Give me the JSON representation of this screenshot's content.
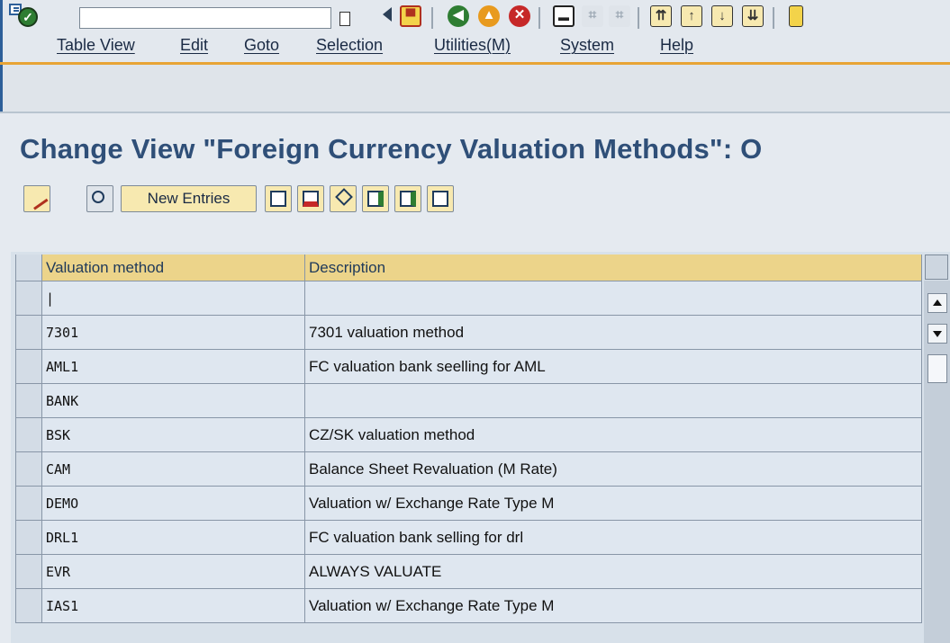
{
  "menu": {
    "items": [
      "Table View",
      "Edit",
      "Goto",
      "Selection",
      "Utilities(M)",
      "System",
      "Help"
    ]
  },
  "toolbar": {
    "command_value": ""
  },
  "page": {
    "title": "Change View \"Foreign Currency Valuation Methods\": O"
  },
  "app_toolbar": {
    "new_entries_label": "New Entries"
  },
  "table": {
    "columns": [
      "Valuation method",
      "Description"
    ],
    "rows": [
      {
        "method": "|",
        "description": ""
      },
      {
        "method": "7301",
        "description": "7301 valuation method"
      },
      {
        "method": "AML1",
        "description": "FC valuation bank seelling for AML"
      },
      {
        "method": "BANK",
        "description": ""
      },
      {
        "method": "BSK",
        "description": "CZ/SK valuation method"
      },
      {
        "method": "CAM",
        "description": "Balance Sheet Revaluation (M Rate)"
      },
      {
        "method": "DEMO",
        "description": "Valuation w/ Exchange Rate Type M"
      },
      {
        "method": "DRL1",
        "description": "FC valuation bank selling for drl"
      },
      {
        "method": "EVR",
        "description": "ALWAYS VALUATE"
      },
      {
        "method": "IAS1",
        "description": "Valuation w/ Exchange Rate Type M"
      }
    ]
  },
  "colors": {
    "accent_orange": "#e8a435",
    "title_blue": "#2f4f78",
    "header_yellow": "#ecd48a",
    "button_yellow": "#f7e9b0"
  }
}
